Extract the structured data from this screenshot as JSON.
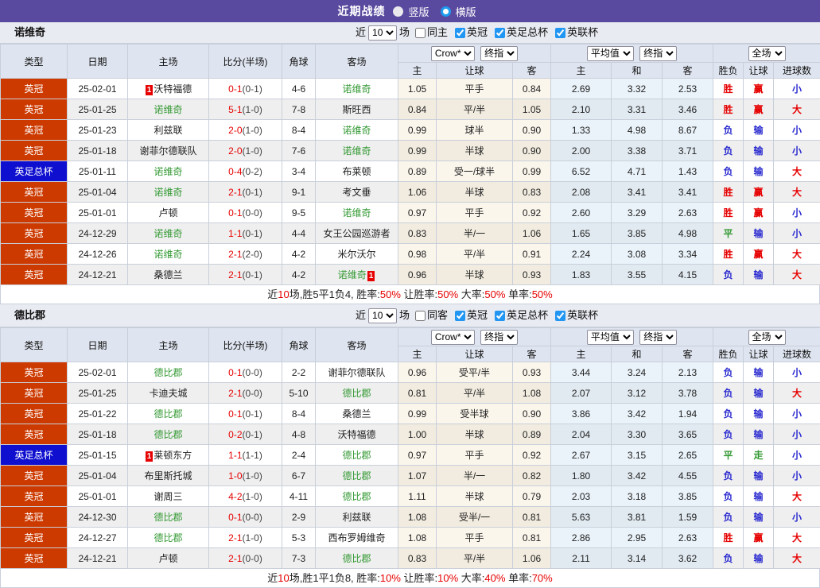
{
  "topbar": {
    "title": "近期战绩",
    "radio_vertical": "竖版",
    "radio_horizontal": "横版"
  },
  "palette": {
    "topbar_purple": "#5a4a9f",
    "league_red": "#cc3a00",
    "cup_blue": "#0f0fd0",
    "focal_team_green": "#339933",
    "score_red": "#e60000",
    "result_win_red": "#e60000",
    "result_lose_blue": "#2b2bd0",
    "result_draw_green": "#339933",
    "checkbox_blue": "#2196f3"
  },
  "chrome": {
    "columns": [
      "类型",
      "日期",
      "主场",
      "比分(半场)",
      "角球",
      "客场"
    ],
    "odds_columns": [
      "主",
      "让球",
      "客",
      "主",
      "和",
      "客",
      "胜负",
      "让球",
      "进球数"
    ],
    "selects": {
      "crow": "Crow*",
      "final": "终指",
      "average": "平均值",
      "scope": "全场"
    },
    "filter": {
      "near": "近",
      "count": "10",
      "matches": "场",
      "leagues": [
        "英冠",
        "英足总杯",
        "英联杯"
      ]
    }
  },
  "tables": [
    {
      "team": "诺维奇",
      "same_label": "同主",
      "rows": [
        {
          "type": "英冠",
          "cup": false,
          "date": "25-02-01",
          "home": {
            "name": "沃特福德",
            "badge": "1",
            "badge_pos": "before"
          },
          "score": "0-1",
          "half": "(0-1)",
          "corner": "4-6",
          "away": {
            "name": "诺维奇",
            "green": true
          },
          "crow": [
            "1.05",
            "平手",
            "0.84"
          ],
          "avg": [
            "2.69",
            "3.32",
            "2.53"
          ],
          "res": [
            [
              "胜",
              "r"
            ],
            [
              "赢",
              "r"
            ],
            [
              "小",
              "b"
            ]
          ]
        },
        {
          "type": "英冠",
          "cup": false,
          "date": "25-01-25",
          "home": {
            "name": "诺维奇",
            "green": true
          },
          "score": "5-1",
          "half": "(1-0)",
          "corner": "7-8",
          "away": {
            "name": "斯旺西"
          },
          "crow": [
            "0.84",
            "平/半",
            "1.05"
          ],
          "avg": [
            "2.10",
            "3.31",
            "3.46"
          ],
          "res": [
            [
              "胜",
              "r"
            ],
            [
              "赢",
              "r"
            ],
            [
              "大",
              "r"
            ]
          ]
        },
        {
          "type": "英冠",
          "cup": false,
          "date": "25-01-23",
          "home": {
            "name": "利兹联"
          },
          "score": "2-0",
          "half": "(1-0)",
          "corner": "8-4",
          "away": {
            "name": "诺维奇",
            "green": true
          },
          "crow": [
            "0.99",
            "球半",
            "0.90"
          ],
          "avg": [
            "1.33",
            "4.98",
            "8.67"
          ],
          "res": [
            [
              "负",
              "b"
            ],
            [
              "输",
              "b"
            ],
            [
              "小",
              "b"
            ]
          ]
        },
        {
          "type": "英冠",
          "cup": false,
          "date": "25-01-18",
          "home": {
            "name": "谢菲尔德联队"
          },
          "score": "2-0",
          "half": "(1-0)",
          "corner": "7-6",
          "away": {
            "name": "诺维奇",
            "green": true
          },
          "crow": [
            "0.99",
            "半球",
            "0.90"
          ],
          "avg": [
            "2.00",
            "3.38",
            "3.71"
          ],
          "res": [
            [
              "负",
              "b"
            ],
            [
              "输",
              "b"
            ],
            [
              "小",
              "b"
            ]
          ]
        },
        {
          "type": "英足总杯",
          "cup": true,
          "date": "25-01-11",
          "home": {
            "name": "诺维奇",
            "green": true
          },
          "score": "0-4",
          "half": "(0-2)",
          "corner": "3-4",
          "away": {
            "name": "布莱顿"
          },
          "crow": [
            "0.89",
            "受一/球半",
            "0.99"
          ],
          "avg": [
            "6.52",
            "4.71",
            "1.43"
          ],
          "res": [
            [
              "负",
              "b"
            ],
            [
              "输",
              "b"
            ],
            [
              "大",
              "r"
            ]
          ]
        },
        {
          "type": "英冠",
          "cup": false,
          "date": "25-01-04",
          "home": {
            "name": "诺维奇",
            "green": true
          },
          "score": "2-1",
          "half": "(0-1)",
          "corner": "9-1",
          "away": {
            "name": "考文垂"
          },
          "crow": [
            "1.06",
            "半球",
            "0.83"
          ],
          "avg": [
            "2.08",
            "3.41",
            "3.41"
          ],
          "res": [
            [
              "胜",
              "r"
            ],
            [
              "赢",
              "r"
            ],
            [
              "大",
              "r"
            ]
          ]
        },
        {
          "type": "英冠",
          "cup": false,
          "date": "25-01-01",
          "home": {
            "name": "卢顿"
          },
          "score": "0-1",
          "half": "(0-0)",
          "corner": "9-5",
          "away": {
            "name": "诺维奇",
            "green": true
          },
          "crow": [
            "0.97",
            "平手",
            "0.92"
          ],
          "avg": [
            "2.60",
            "3.29",
            "2.63"
          ],
          "res": [
            [
              "胜",
              "r"
            ],
            [
              "赢",
              "r"
            ],
            [
              "小",
              "b"
            ]
          ]
        },
        {
          "type": "英冠",
          "cup": false,
          "date": "24-12-29",
          "home": {
            "name": "诺维奇",
            "green": true
          },
          "score": "1-1",
          "half": "(0-1)",
          "corner": "4-4",
          "away": {
            "name": "女王公园巡游者"
          },
          "crow": [
            "0.83",
            "半/一",
            "1.06"
          ],
          "avg": [
            "1.65",
            "3.85",
            "4.98"
          ],
          "res": [
            [
              "平",
              "g"
            ],
            [
              "输",
              "b"
            ],
            [
              "小",
              "b"
            ]
          ]
        },
        {
          "type": "英冠",
          "cup": false,
          "date": "24-12-26",
          "home": {
            "name": "诺维奇",
            "green": true
          },
          "score": "2-1",
          "half": "(2-0)",
          "corner": "4-2",
          "away": {
            "name": "米尔沃尔"
          },
          "crow": [
            "0.98",
            "平/半",
            "0.91"
          ],
          "avg": [
            "2.24",
            "3.08",
            "3.34"
          ],
          "res": [
            [
              "胜",
              "r"
            ],
            [
              "赢",
              "r"
            ],
            [
              "大",
              "r"
            ]
          ]
        },
        {
          "type": "英冠",
          "cup": false,
          "date": "24-12-21",
          "home": {
            "name": "桑德兰"
          },
          "score": "2-1",
          "half": "(0-1)",
          "corner": "4-2",
          "away": {
            "name": "诺维奇",
            "green": true,
            "badge": "1",
            "badge_pos": "after"
          },
          "crow": [
            "0.96",
            "半球",
            "0.93"
          ],
          "avg": [
            "1.83",
            "3.55",
            "4.15"
          ],
          "res": [
            [
              "负",
              "b"
            ],
            [
              "输",
              "b"
            ],
            [
              "大",
              "r"
            ]
          ]
        }
      ],
      "summary": [
        {
          "t": "近"
        },
        {
          "t": "10",
          "red": true
        },
        {
          "t": "场,胜5平1负4, 胜率:"
        },
        {
          "t": "50%",
          "red": true
        },
        {
          "t": " 让胜率:"
        },
        {
          "t": "50%",
          "red": true
        },
        {
          "t": " 大率:"
        },
        {
          "t": "50%",
          "red": true
        },
        {
          "t": " 单率:"
        },
        {
          "t": "50%",
          "red": true
        }
      ]
    },
    {
      "team": "德比郡",
      "same_label": "同客",
      "rows": [
        {
          "type": "英冠",
          "cup": false,
          "date": "25-02-01",
          "home": {
            "name": "德比郡",
            "green": true
          },
          "score": "0-1",
          "half": "(0-0)",
          "corner": "2-2",
          "away": {
            "name": "谢菲尔德联队"
          },
          "crow": [
            "0.96",
            "受平/半",
            "0.93"
          ],
          "avg": [
            "3.44",
            "3.24",
            "2.13"
          ],
          "res": [
            [
              "负",
              "b"
            ],
            [
              "输",
              "b"
            ],
            [
              "小",
              "b"
            ]
          ]
        },
        {
          "type": "英冠",
          "cup": false,
          "date": "25-01-25",
          "home": {
            "name": "卡迪夫城"
          },
          "score": "2-1",
          "half": "(0-0)",
          "corner": "5-10",
          "away": {
            "name": "德比郡",
            "green": true
          },
          "crow": [
            "0.81",
            "平/半",
            "1.08"
          ],
          "avg": [
            "2.07",
            "3.12",
            "3.78"
          ],
          "res": [
            [
              "负",
              "b"
            ],
            [
              "输",
              "b"
            ],
            [
              "大",
              "r"
            ]
          ]
        },
        {
          "type": "英冠",
          "cup": false,
          "date": "25-01-22",
          "home": {
            "name": "德比郡",
            "green": true
          },
          "score": "0-1",
          "half": "(0-1)",
          "corner": "8-4",
          "away": {
            "name": "桑德兰"
          },
          "crow": [
            "0.99",
            "受半球",
            "0.90"
          ],
          "avg": [
            "3.86",
            "3.42",
            "1.94"
          ],
          "res": [
            [
              "负",
              "b"
            ],
            [
              "输",
              "b"
            ],
            [
              "小",
              "b"
            ]
          ]
        },
        {
          "type": "英冠",
          "cup": false,
          "date": "25-01-18",
          "home": {
            "name": "德比郡",
            "green": true
          },
          "score": "0-2",
          "half": "(0-1)",
          "corner": "4-8",
          "away": {
            "name": "沃特福德"
          },
          "crow": [
            "1.00",
            "半球",
            "0.89"
          ],
          "avg": [
            "2.04",
            "3.30",
            "3.65"
          ],
          "res": [
            [
              "负",
              "b"
            ],
            [
              "输",
              "b"
            ],
            [
              "小",
              "b"
            ]
          ]
        },
        {
          "type": "英足总杯",
          "cup": true,
          "date": "25-01-15",
          "home": {
            "name": "莱顿东方",
            "badge": "1",
            "badge_pos": "before"
          },
          "score": "1-1",
          "half": "(1-1)",
          "corner": "2-4",
          "away": {
            "name": "德比郡",
            "green": true
          },
          "crow": [
            "0.97",
            "平手",
            "0.92"
          ],
          "avg": [
            "2.67",
            "3.15",
            "2.65"
          ],
          "res": [
            [
              "平",
              "g"
            ],
            [
              "走",
              "g"
            ],
            [
              "小",
              "b"
            ]
          ]
        },
        {
          "type": "英冠",
          "cup": false,
          "date": "25-01-04",
          "home": {
            "name": "布里斯托城"
          },
          "score": "1-0",
          "half": "(1-0)",
          "corner": "6-7",
          "away": {
            "name": "德比郡",
            "green": true
          },
          "crow": [
            "1.07",
            "半/一",
            "0.82"
          ],
          "avg": [
            "1.80",
            "3.42",
            "4.55"
          ],
          "res": [
            [
              "负",
              "b"
            ],
            [
              "输",
              "b"
            ],
            [
              "小",
              "b"
            ]
          ]
        },
        {
          "type": "英冠",
          "cup": false,
          "date": "25-01-01",
          "home": {
            "name": "谢周三"
          },
          "score": "4-2",
          "half": "(1-0)",
          "corner": "4-11",
          "away": {
            "name": "德比郡",
            "green": true
          },
          "crow": [
            "1.11",
            "半球",
            "0.79"
          ],
          "avg": [
            "2.03",
            "3.18",
            "3.85"
          ],
          "res": [
            [
              "负",
              "b"
            ],
            [
              "输",
              "b"
            ],
            [
              "大",
              "r"
            ]
          ]
        },
        {
          "type": "英冠",
          "cup": false,
          "date": "24-12-30",
          "home": {
            "name": "德比郡",
            "green": true
          },
          "score": "0-1",
          "half": "(0-0)",
          "corner": "2-9",
          "away": {
            "name": "利兹联"
          },
          "crow": [
            "1.08",
            "受半/一",
            "0.81"
          ],
          "avg": [
            "5.63",
            "3.81",
            "1.59"
          ],
          "res": [
            [
              "负",
              "b"
            ],
            [
              "输",
              "b"
            ],
            [
              "小",
              "b"
            ]
          ]
        },
        {
          "type": "英冠",
          "cup": false,
          "date": "24-12-27",
          "home": {
            "name": "德比郡",
            "green": true
          },
          "score": "2-1",
          "half": "(1-0)",
          "corner": "5-3",
          "away": {
            "name": "西布罗姆维奇"
          },
          "crow": [
            "1.08",
            "平手",
            "0.81"
          ],
          "avg": [
            "2.86",
            "2.95",
            "2.63"
          ],
          "res": [
            [
              "胜",
              "r"
            ],
            [
              "赢",
              "r"
            ],
            [
              "大",
              "r"
            ]
          ]
        },
        {
          "type": "英冠",
          "cup": false,
          "date": "24-12-21",
          "home": {
            "name": "卢顿"
          },
          "score": "2-1",
          "half": "(0-0)",
          "corner": "7-3",
          "away": {
            "name": "德比郡",
            "green": true
          },
          "crow": [
            "0.83",
            "平/半",
            "1.06"
          ],
          "avg": [
            "2.11",
            "3.14",
            "3.62"
          ],
          "res": [
            [
              "负",
              "b"
            ],
            [
              "输",
              "b"
            ],
            [
              "大",
              "r"
            ]
          ]
        }
      ],
      "summary": [
        {
          "t": "近"
        },
        {
          "t": "10",
          "red": true
        },
        {
          "t": "场,胜1平1负8, 胜率:"
        },
        {
          "t": "10%",
          "red": true
        },
        {
          "t": " 让胜率:"
        },
        {
          "t": "10%",
          "red": true
        },
        {
          "t": " 大率:"
        },
        {
          "t": "40%",
          "red": true
        },
        {
          "t": " 单率:"
        },
        {
          "t": "70%",
          "red": true
        }
      ]
    }
  ]
}
